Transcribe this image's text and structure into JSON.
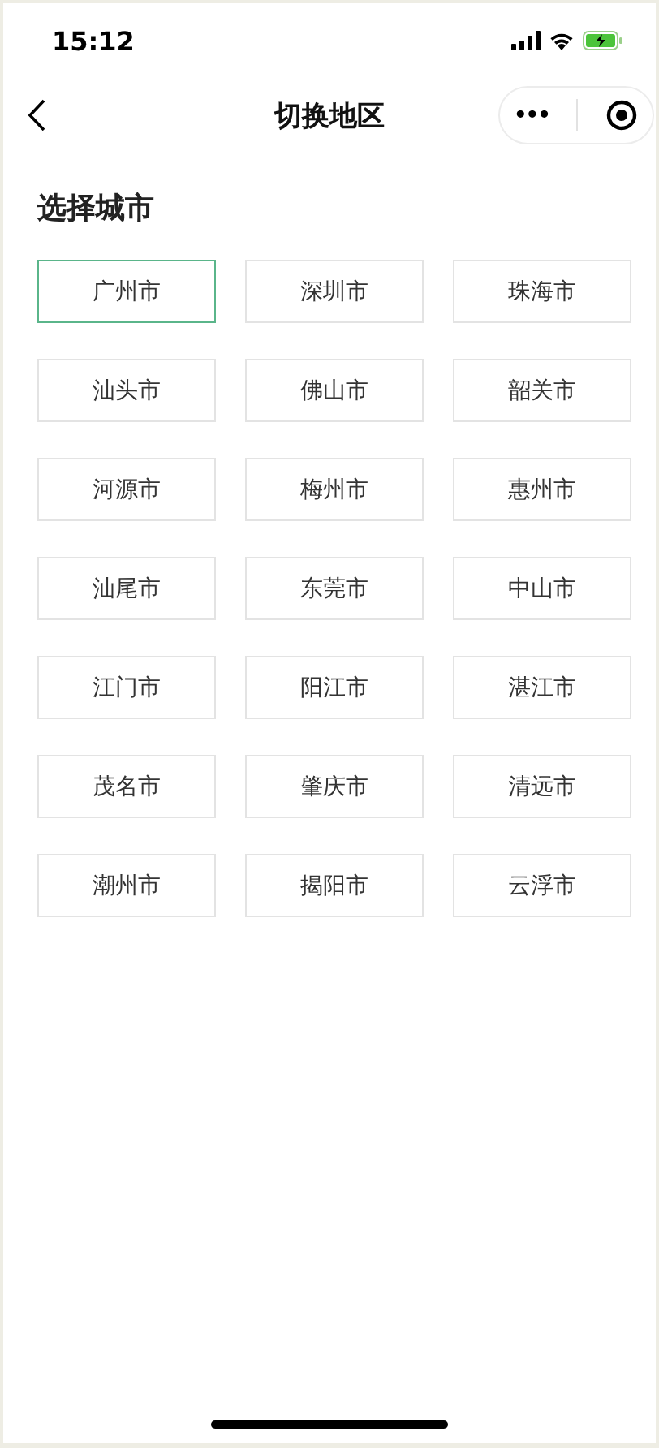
{
  "status_bar": {
    "time": "15:12"
  },
  "nav_bar": {
    "title": "切换地区",
    "menu_glyph": "•••"
  },
  "section_title": "选择城市",
  "cities": [
    {
      "label": "广州市",
      "selected": true
    },
    {
      "label": "深圳市",
      "selected": false
    },
    {
      "label": "珠海市",
      "selected": false
    },
    {
      "label": "汕头市",
      "selected": false
    },
    {
      "label": "佛山市",
      "selected": false
    },
    {
      "label": "韶关市",
      "selected": false
    },
    {
      "label": "河源市",
      "selected": false
    },
    {
      "label": "梅州市",
      "selected": false
    },
    {
      "label": "惠州市",
      "selected": false
    },
    {
      "label": "汕尾市",
      "selected": false
    },
    {
      "label": "东莞市",
      "selected": false
    },
    {
      "label": "中山市",
      "selected": false
    },
    {
      "label": "江门市",
      "selected": false
    },
    {
      "label": "阳江市",
      "selected": false
    },
    {
      "label": "湛江市",
      "selected": false
    },
    {
      "label": "茂名市",
      "selected": false
    },
    {
      "label": "肇庆市",
      "selected": false
    },
    {
      "label": "清远市",
      "selected": false
    },
    {
      "label": "潮州市",
      "selected": false
    },
    {
      "label": "揭阳市",
      "selected": false
    },
    {
      "label": "云浮市",
      "selected": false
    }
  ]
}
